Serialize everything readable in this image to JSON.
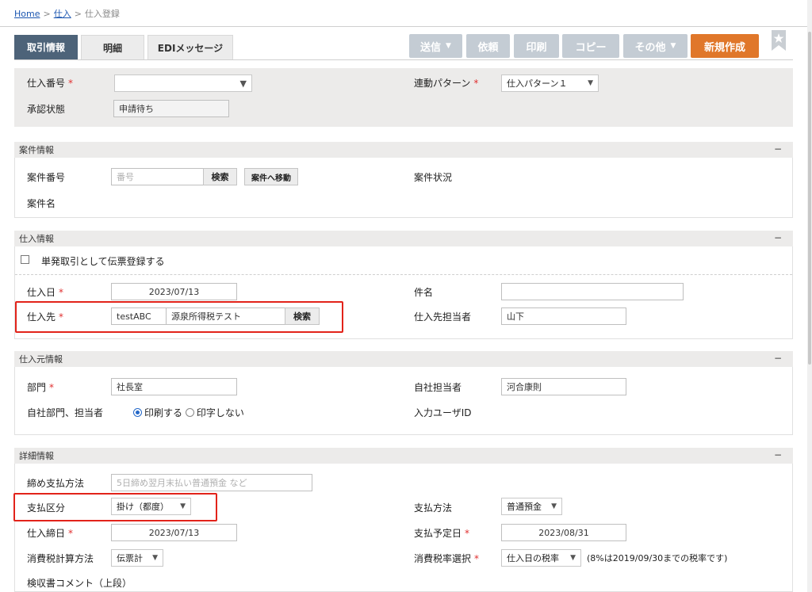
{
  "breadcrumb": {
    "home": "Home",
    "sep": ">",
    "level1": "仕入",
    "current": "仕入登録"
  },
  "tabs": [
    {
      "label": "取引情報"
    },
    {
      "label": "明細"
    },
    {
      "label": "EDIメッセージ"
    }
  ],
  "actions": {
    "send": "送信",
    "request": "依頼",
    "print": "印刷",
    "copy": "コピー",
    "other": "その他",
    "new": "新規作成"
  },
  "top": {
    "purchase_no_label": "仕入番号",
    "purchase_no_value": "",
    "approval_label": "承認状態",
    "approval_value": "申請待ち",
    "link_pattern_label": "連動パターン",
    "link_pattern_value": "仕入パターン１"
  },
  "project": {
    "header": "案件情報",
    "no_label": "案件番号",
    "no_placeholder": "番号",
    "search_btn": "検索",
    "goto_btn": "案件へ移動",
    "name_label": "案件名",
    "status_label": "案件状況"
  },
  "purchase": {
    "header": "仕入情報",
    "oneoff_label": "単発取引として伝票登録する",
    "date_label": "仕入日",
    "date_value": "2023/07/13",
    "supplier_label": "仕入先",
    "supplier_code": "testABC",
    "supplier_name": "源泉所得税テスト",
    "search_btn": "検索",
    "subject_label": "件名",
    "subject_value": "",
    "contact_label": "仕入先担当者",
    "contact_value": "山下"
  },
  "source": {
    "header": "仕入元情報",
    "dept_label": "部門",
    "dept_value": "社長室",
    "own_dept_label": "自社部門、担当者",
    "print_label": "印刷する",
    "noprint_label": "印字しない",
    "own_contact_label": "自社担当者",
    "own_contact_value": "河合康則",
    "input_user_label": "入力ユーザID"
  },
  "detail": {
    "header": "詳細情報",
    "closing_label": "締め支払方法",
    "closing_placeholder": "5日締め翌月末払い普通預金 など",
    "pay_type_label": "支払区分",
    "pay_type_value": "掛け（都度）",
    "pay_method_label": "支払方法",
    "pay_method_value": "普通預金",
    "closing_date_label": "仕入締日",
    "closing_date_value": "2023/07/13",
    "due_date_label": "支払予定日",
    "due_date_value": "2023/08/31",
    "tax_calc_label": "消費税計算方法",
    "tax_calc_value": "伝票計",
    "tax_rate_label": "消費税率選択",
    "tax_rate_value": "仕入日の税率",
    "tax_rate_note": "(8%は2019/09/30までの税率です)",
    "comment_label": "検収書コメント（上段）"
  },
  "collapse_symbol": "−",
  "colors": {
    "accent": "#e0772a",
    "tab_active": "#4d6379",
    "required": "#e03030",
    "highlight": "#e2231a"
  }
}
